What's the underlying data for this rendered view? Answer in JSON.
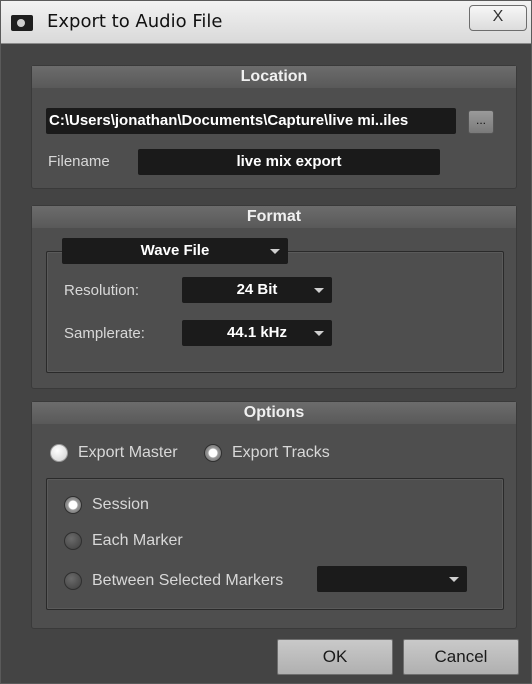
{
  "window": {
    "title": "Export to Audio File",
    "close_glyph": "X"
  },
  "location": {
    "header": "Location",
    "path": "C:\\Users\\jonathan\\Documents\\Capture\\live mi..iles",
    "browse_label": "...",
    "filename_label": "Filename",
    "filename_value": "live mix export"
  },
  "format": {
    "header": "Format",
    "file_type": "Wave File",
    "resolution_label": "Resolution:",
    "resolution_value": "24 Bit",
    "samplerate_label": "Samplerate:",
    "samplerate_value": "44.1 kHz"
  },
  "options": {
    "header": "Options",
    "export_master_label": "Export Master",
    "export_tracks_label": "Export Tracks",
    "session_label": "Session",
    "each_marker_label": "Each Marker",
    "between_markers_label": "Between Selected Markers",
    "between_markers_value": ""
  },
  "buttons": {
    "ok": "OK",
    "cancel": "Cancel"
  }
}
